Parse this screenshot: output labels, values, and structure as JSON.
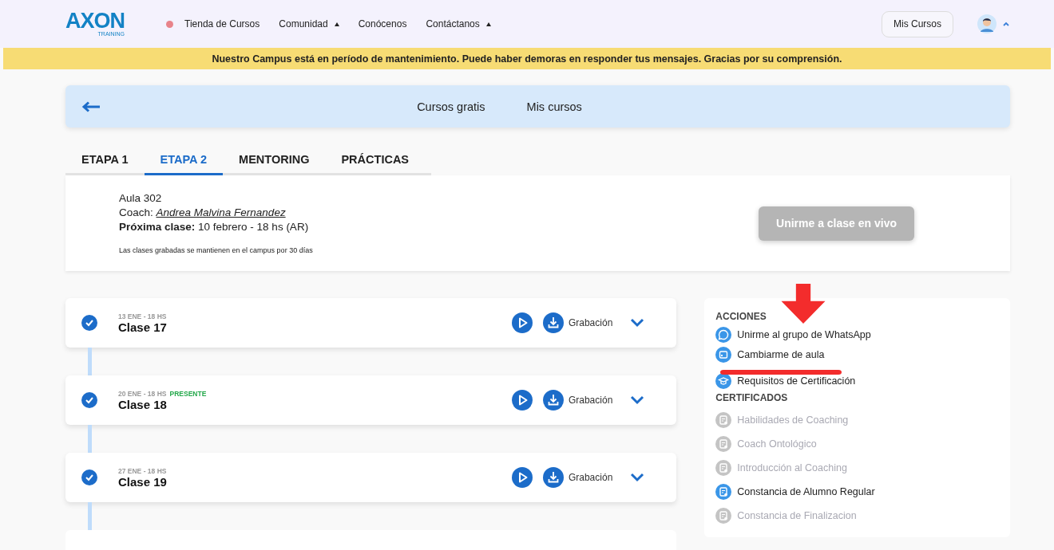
{
  "header": {
    "logo": "AXON",
    "logo_sub": "TRAINING",
    "nav": [
      {
        "label": "Tienda de Cursos",
        "dot": true,
        "dropdown": false
      },
      {
        "label": "Comunidad",
        "dot": false,
        "dropdown": true
      },
      {
        "label": "Conócenos",
        "dot": false,
        "dropdown": false
      },
      {
        "label": "Contáctanos",
        "dot": false,
        "dropdown": true
      }
    ],
    "my_courses_button": "Mis Cursos"
  },
  "banner": "Nuestro Campus está en período de mantenimiento. Puede haber demoras en responder tus mensajes. Gracias por su comprensión.",
  "subnav": {
    "links": [
      {
        "label": "Cursos gratis",
        "selected": false
      },
      {
        "label": "Mis cursos",
        "selected": false
      }
    ]
  },
  "tabs": [
    {
      "label": "ETAPA 1",
      "selected": false
    },
    {
      "label": "ETAPA 2",
      "selected": true
    },
    {
      "label": "MENTORING",
      "selected": false
    },
    {
      "label": "PRÁCTICAS",
      "selected": false
    }
  ],
  "classroom": {
    "title": "Aula 302",
    "coach_label": "Coach:",
    "coach": "Andrea Malvina Fernandez",
    "next_class": "**Próxima clase:** 10 febrero - 18 hs (AR)",
    "note": "Las clases grabadas se mantienen en el campus por 30 días",
    "join_button": {
      "label": "Unirme a clase en vivo",
      "disabled": true
    }
  },
  "classes": [
    {
      "date": "13 ENE - 18 HS",
      "title": "Clase 17",
      "completed": true,
      "recording": "Grabación"
    },
    {
      "date": "20 ENE - 18 HS",
      "present": "PRESENTE",
      "title": "Clase 18",
      "completed": true,
      "recording": "Grabación"
    },
    {
      "date": "27 ENE - 18 HS",
      "title": "Clase 19",
      "completed": true,
      "recording": "Grabación"
    }
  ],
  "actions": {
    "title": "ACCIONES",
    "items": [
      {
        "kind": "whatsapp",
        "label": "Unirme al grupo de WhatsApp"
      },
      {
        "kind": "calendar",
        "label": "Cambiarme de aula"
      },
      {
        "kind": "cap",
        "label": "Requisitos de Certificación"
      }
    ]
  },
  "certificates": {
    "title": "CERTIFICADOS",
    "items": [
      {
        "label": "Habilidades de Coaching",
        "disabled": true
      },
      {
        "label": "Coach Ontológico",
        "disabled": true
      },
      {
        "label": "Introducción al Coaching",
        "disabled": true
      },
      {
        "label": "Constancia de Alumno Regular",
        "disabled": false
      },
      {
        "label": "Constancia de Finalizacion",
        "disabled": true
      }
    ]
  }
}
